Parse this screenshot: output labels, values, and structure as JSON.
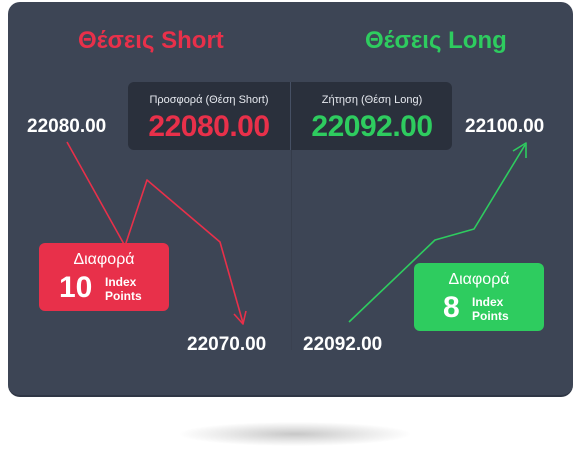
{
  "headings": {
    "short": "Θέσεις Short",
    "long": "Θέσεις Long"
  },
  "quote": {
    "bid_label": "Προσφορά (Θέση Short)",
    "bid_value": "22080.00",
    "ask_label": "Ζήτηση (Θέση Long)",
    "ask_value": "22092.00"
  },
  "levels": {
    "short_entry": "22080.00",
    "short_exit": "22070.00",
    "long_entry": "22092.00",
    "long_exit": "22100.00"
  },
  "short_difference": {
    "title": "Διαφορά",
    "value": "10",
    "unit_line1": "Index",
    "unit_line2": "Points"
  },
  "long_difference": {
    "title": "Διαφορά",
    "value": "8",
    "unit_line1": "Index",
    "unit_line2": "Points"
  },
  "colors": {
    "background": "#3d4555",
    "short": "#e8304a",
    "long": "#2ecc5f",
    "price_box": "#2a303c",
    "text": "#ffffff"
  }
}
